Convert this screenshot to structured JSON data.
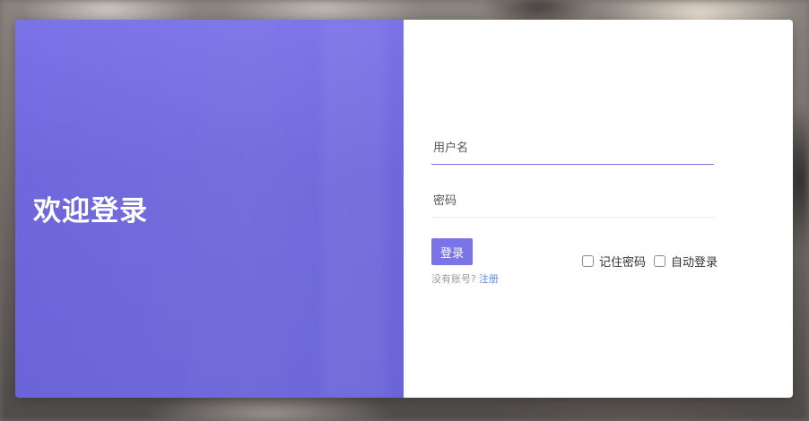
{
  "login_panel": {
    "welcome_title": "欢迎登录"
  },
  "form": {
    "username": {
      "value": "",
      "placeholder": "用户名"
    },
    "password": {
      "value": "",
      "placeholder": "密码"
    },
    "login_button_label": "登录",
    "remember_password_label": "记住密码",
    "auto_login_label": "自动登录",
    "no_account_text": "没有账号?",
    "register_link_label": "注册"
  },
  "colors": {
    "accent": "#7b74e6",
    "left_panel": "#6f68dc",
    "link": "#5a8ddb"
  }
}
